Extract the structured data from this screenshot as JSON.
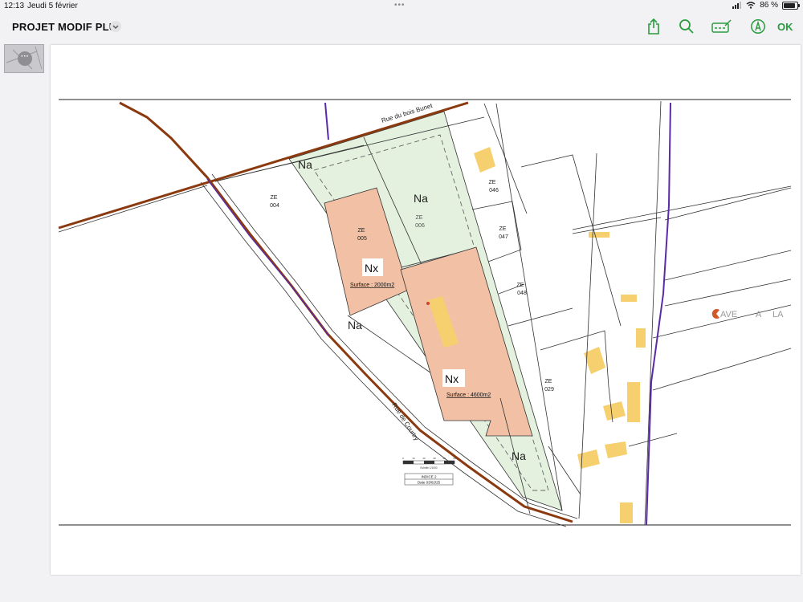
{
  "status": {
    "time": "12:13",
    "date": "Jeudi 5 février",
    "battery": "86 %"
  },
  "document": {
    "title": "PROJET MODIF PLU"
  },
  "toolbar": {
    "ok_label": "OK"
  },
  "colors": {
    "accent": "#2a9b3f",
    "zone_na": "#e3f1de",
    "zone_nx": "#f2c0a4",
    "road": "#8b3a10",
    "boundary": "#5b2aa6",
    "building": "#f6cf6e"
  },
  "map": {
    "road_north": "Rue du bois Bunet",
    "road_south": "Rue de Courtry",
    "zones": {
      "na_top_left": "Na",
      "na_top": "Na",
      "na_mid": "Na",
      "na_bottom": "Na",
      "nx_small": "Nx",
      "nx_large": "Nx"
    },
    "surfaces": {
      "nx_small": "Surface : 2000m2",
      "nx_large": "Surface : 4600m2"
    },
    "parcels": {
      "ze004": {
        "prefix": "ZE",
        "number": "004"
      },
      "ze005": {
        "prefix": "ZE",
        "number": "005"
      },
      "ze006": {
        "prefix": "ZE",
        "number": "006"
      },
      "ze046": {
        "prefix": "ZE",
        "number": "046"
      },
      "ze047": {
        "prefix": "ZE",
        "number": "047"
      },
      "ze048": {
        "prefix": "ZE",
        "number": "048"
      },
      "ze029": {
        "prefix": "ZE",
        "number": "029"
      }
    },
    "watermark": {
      "part1": "AVE",
      "part2": "A",
      "part3": "LA"
    },
    "cartouche": {
      "scale_caption": "Echelle 1/1000",
      "indice": "INDICE 2",
      "date": "Date 03/02/25",
      "scale_ticks": [
        "0",
        "10",
        "20",
        "30",
        "40",
        "50"
      ]
    }
  }
}
